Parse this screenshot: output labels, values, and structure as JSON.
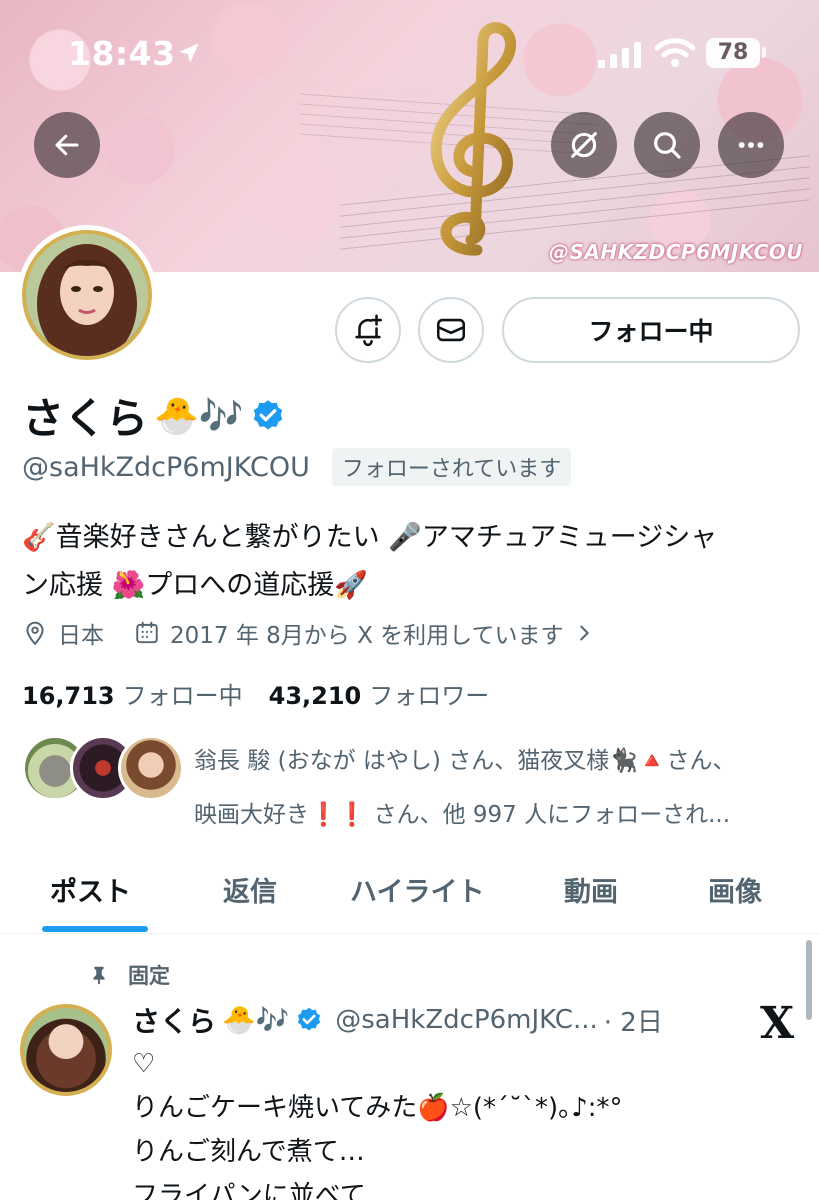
{
  "status_bar": {
    "time": "18:43",
    "battery": "78"
  },
  "banner": {
    "watermark": "@SAHKZDCP6MJKCOU"
  },
  "header_buttons": [
    "back-icon",
    "grok-icon",
    "search-icon",
    "more-icon"
  ],
  "profile": {
    "name": "さくら",
    "name_emoji": "🐣🎶",
    "handle": "@saHkZdcP6mJKCOU",
    "follows_you": "フォローされています",
    "bio_line1": "🎸音楽好きさんと繋がりたい 🎤アマチュアミュージシャ",
    "bio_line2": "ン応援 🌺プロへの道応援🚀",
    "location": "日本",
    "joined": "2017 年 8月から X を利用しています",
    "following_count": "16,713",
    "following_label": "フォロー中",
    "followers_count": "43,210",
    "followers_label": "フォロワー",
    "mutuals_line1": "翁長 駿 (おなが はやし) さん、猫夜叉様🐈‍⬛🔺さん、",
    "mutuals_line2": "映画大好き❗️❗️ さん、他 997 人にフォローされ..."
  },
  "actions": {
    "follow_label": "フォロー中"
  },
  "tabs": [
    {
      "label": "ポスト",
      "active": true
    },
    {
      "label": "返信",
      "active": false
    },
    {
      "label": "ハイライト",
      "active": false
    },
    {
      "label": "動画",
      "active": false
    },
    {
      "label": "画像",
      "active": false
    }
  ],
  "pinned_post": {
    "pinned_label": "固定",
    "author": "さくら",
    "author_emoji": "🐣🎶",
    "handle": "@saHkZdcP6mJKC...",
    "time": "· 2日",
    "x_logo": "X",
    "lines": [
      "♡",
      "りんごケーキ焼いてみた🍎☆(*´˘`*)｡♪:*°",
      "りんご刻んで煮て…",
      "フライパンに並べて…"
    ]
  },
  "colors": {
    "accent": "#1d9bf0",
    "secondary_text": "#536471",
    "verified": "#1d9bf0",
    "avatar_ring": "#d4b053"
  }
}
